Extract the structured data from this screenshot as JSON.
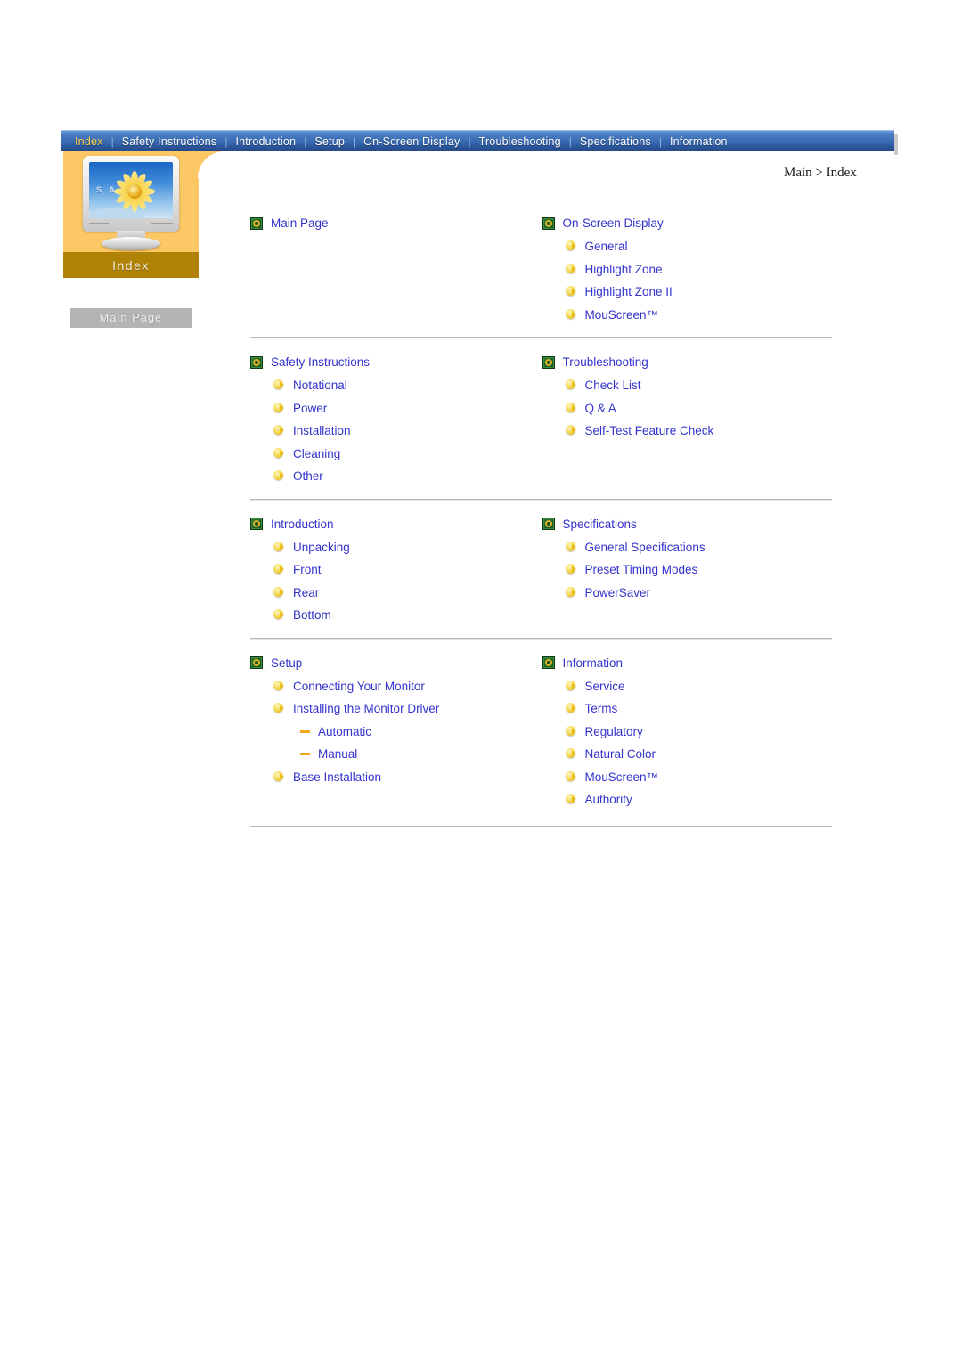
{
  "nav": {
    "items": [
      {
        "label": "Index",
        "active": true
      },
      {
        "label": "Safety Instructions",
        "active": false
      },
      {
        "label": "Introduction",
        "active": false
      },
      {
        "label": "Setup",
        "active": false
      },
      {
        "label": "On-Screen Display",
        "active": false
      },
      {
        "label": "Troubleshooting",
        "active": false
      },
      {
        "label": "Specifications",
        "active": false
      },
      {
        "label": "Information",
        "active": false
      }
    ],
    "separator": "|"
  },
  "sidebar": {
    "label": "Index",
    "monitor_brand_text": "S A M",
    "main_page_button": "Main Page"
  },
  "breadcrumb": "Main > Index",
  "icons": {
    "section": "green-square-icon",
    "sub": "yellow-circle-arrow-icon",
    "leaf": "orange-dash-icon"
  },
  "colors": {
    "link": "#3333cc",
    "panel_orange": "#fcc765",
    "panel_label": "#b08307",
    "nav_active": "#ffd24d",
    "divider": "#b9b9b9"
  },
  "index": {
    "blocks": [
      {
        "left": {
          "title": "Main Page",
          "items": []
        },
        "right": {
          "title": "On-Screen Display",
          "items": [
            {
              "label": "General",
              "level": 1
            },
            {
              "label": "Highlight Zone",
              "level": 1
            },
            {
              "label": "Highlight Zone II",
              "level": 1
            },
            {
              "label": "MouScreen™",
              "level": 1
            }
          ]
        }
      },
      {
        "left": {
          "title": "Safety Instructions",
          "items": [
            {
              "label": "Notational",
              "level": 1
            },
            {
              "label": "Power",
              "level": 1
            },
            {
              "label": "Installation",
              "level": 1
            },
            {
              "label": "Cleaning",
              "level": 1
            },
            {
              "label": "Other",
              "level": 1
            }
          ]
        },
        "right": {
          "title": "Troubleshooting",
          "items": [
            {
              "label": "Check List",
              "level": 1
            },
            {
              "label": "Q & A",
              "level": 1
            },
            {
              "label": "Self-Test Feature Check",
              "level": 1
            }
          ]
        }
      },
      {
        "left": {
          "title": "Introduction",
          "items": [
            {
              "label": "Unpacking",
              "level": 1
            },
            {
              "label": "Front",
              "level": 1
            },
            {
              "label": "Rear",
              "level": 1
            },
            {
              "label": "Bottom",
              "level": 1
            }
          ]
        },
        "right": {
          "title": "Specifications",
          "items": [
            {
              "label": "General Specifications",
              "level": 1
            },
            {
              "label": "Preset Timing Modes",
              "level": 1
            },
            {
              "label": "PowerSaver",
              "level": 1
            }
          ]
        }
      },
      {
        "left": {
          "title": "Setup",
          "items": [
            {
              "label": "Connecting Your Monitor",
              "level": 1
            },
            {
              "label": "Installing the Monitor Driver",
              "level": 1
            },
            {
              "label": "Automatic",
              "level": 2
            },
            {
              "label": "Manual",
              "level": 2
            },
            {
              "label": "Base Installation",
              "level": 1
            }
          ]
        },
        "right": {
          "title": "Information",
          "items": [
            {
              "label": "Service",
              "level": 1
            },
            {
              "label": "Terms",
              "level": 1
            },
            {
              "label": "Regulatory",
              "level": 1
            },
            {
              "label": "Natural Color",
              "level": 1
            },
            {
              "label": "MouScreen™",
              "level": 1
            },
            {
              "label": "Authority",
              "level": 1
            }
          ]
        }
      }
    ]
  }
}
